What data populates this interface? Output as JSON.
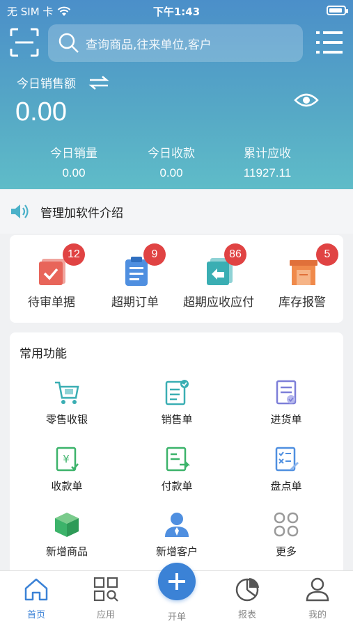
{
  "status_bar": {
    "carrier": "无 SIM 卡",
    "time": "下午1:43",
    "battery_level": 0.9
  },
  "search": {
    "placeholder": "查询商品,往来单位,客户"
  },
  "sales": {
    "label": "今日销售额",
    "value": "0.00"
  },
  "stats": [
    {
      "label": "今日销量",
      "value": "0.00"
    },
    {
      "label": "今日收款",
      "value": "0.00"
    },
    {
      "label": "累计应收",
      "value": "11927.11"
    }
  ],
  "notice": {
    "text": "管理加软件介绍"
  },
  "alerts": [
    {
      "label": "待审单据",
      "badge": "12",
      "icon": "approval-doc-icon",
      "color": "#e8655a"
    },
    {
      "label": "超期订单",
      "badge": "9",
      "icon": "clipboard-icon",
      "color": "#4f8fe0"
    },
    {
      "label": "超期应收应付",
      "badge": "86",
      "icon": "return-doc-icon",
      "color": "#3aaeb3"
    },
    {
      "label": "库存报警",
      "badge": "5",
      "icon": "warehouse-icon",
      "color": "#f08a4b"
    }
  ],
  "functions": {
    "title": "常用功能",
    "items": [
      {
        "label": "零售收银",
        "icon": "cart-icon"
      },
      {
        "label": "销售单",
        "icon": "sales-doc-icon"
      },
      {
        "label": "进货单",
        "icon": "purchase-doc-icon"
      },
      {
        "label": "收款单",
        "icon": "receipt-icon"
      },
      {
        "label": "付款单",
        "icon": "payment-icon"
      },
      {
        "label": "盘点单",
        "icon": "inventory-icon"
      },
      {
        "label": "新增商品",
        "icon": "box-icon"
      },
      {
        "label": "新增客户",
        "icon": "customer-icon"
      },
      {
        "label": "更多",
        "icon": "more-icon"
      }
    ]
  },
  "tabs": [
    {
      "label": "首页",
      "icon": "home-icon",
      "active": true
    },
    {
      "label": "应用",
      "icon": "apps-icon",
      "active": false
    },
    {
      "label": "开单",
      "icon": "plus-icon",
      "active": false
    },
    {
      "label": "报表",
      "icon": "pie-chart-icon",
      "active": false
    },
    {
      "label": "我的",
      "icon": "user-icon",
      "active": false
    }
  ],
  "colors": {
    "primary": "#3b82d6",
    "badge": "#e04343",
    "hero_top": "#4b8fc9",
    "hero_bottom": "#5fbcc8"
  }
}
